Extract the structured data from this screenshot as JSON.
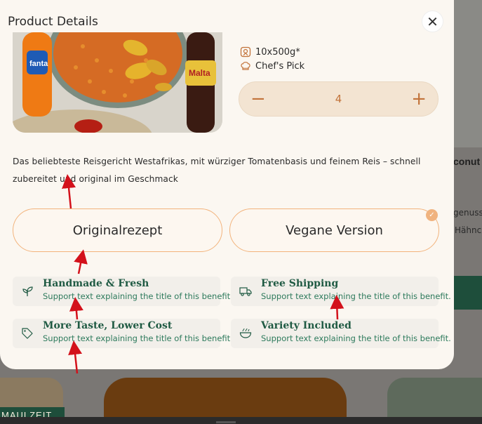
{
  "modal": {
    "title": "Product Details",
    "close_symbol": "✕"
  },
  "product": {
    "pack_size": "10x500g*",
    "badge": "Chef's Pick",
    "quantity": "4",
    "decrement_symbol": "−",
    "increment_symbol": "+",
    "description": "Das beliebteste Reisgericht Westafrikas, mit würziger Tomatenbasis und feinem Reis – schnell zubereitet und original im Geschmack"
  },
  "options": [
    {
      "label": "Originalrezept",
      "selected": false
    },
    {
      "label": "Vegane Version",
      "selected": true
    }
  ],
  "benefits": [
    {
      "icon": "sprout-icon",
      "title": "Handmade & Fresh",
      "text": "Support text explaining the title of this benefit."
    },
    {
      "icon": "truck-icon",
      "title": "Free Shipping",
      "text": "Support text explaining the title of this benefit."
    },
    {
      "icon": "tag-icon",
      "title": "More Taste, Lower Cost",
      "text": "Support text explaining the title of this benefit."
    },
    {
      "icon": "bowl-icon",
      "title": "Variety Included",
      "text": "Support text explaining the title of this benefit."
    }
  ],
  "background": {
    "right_heading": "conut",
    "right_text_1": "genuss",
    "right_text_2": "Hähnc",
    "bottom_left_label": "MAULZEIT"
  },
  "colors": {
    "accent_orange": "#f2b37c",
    "qty_text": "#c2733a",
    "benefit_green": "#1f5a43",
    "annotation_red": "#d3111b"
  }
}
